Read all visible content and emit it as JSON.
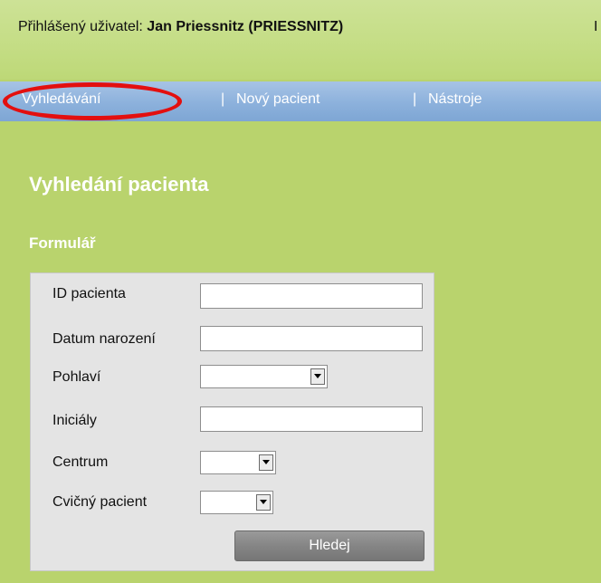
{
  "header": {
    "user_label": "Přihlášený uživatel:",
    "user_name": "Jan Priessnitz (PRIESSNITZ)",
    "edge_glyph": "I"
  },
  "nav": {
    "items": [
      {
        "label": "Vyhledávání"
      },
      {
        "label": "Nový pacient"
      },
      {
        "label": "Nástroje"
      }
    ],
    "separator": "|",
    "highlight_color": "#e30f0f"
  },
  "page": {
    "title": "Vyhledání pacienta",
    "section": "Formulář"
  },
  "form": {
    "fields": [
      {
        "label": "ID pacienta",
        "value": ""
      },
      {
        "label": "Datum narození",
        "value": ""
      },
      {
        "label": "Pohlaví",
        "value": ""
      },
      {
        "label": "Iniciály",
        "value": ""
      },
      {
        "label": "Centrum",
        "value": ""
      },
      {
        "label": "Cvičný pacient",
        "value": ""
      }
    ],
    "submit_label": "Hledej"
  },
  "colors": {
    "page_bg": "#b9d36d",
    "nav_bg": "#8cb1dc",
    "form_bg": "#e4e4e4"
  }
}
